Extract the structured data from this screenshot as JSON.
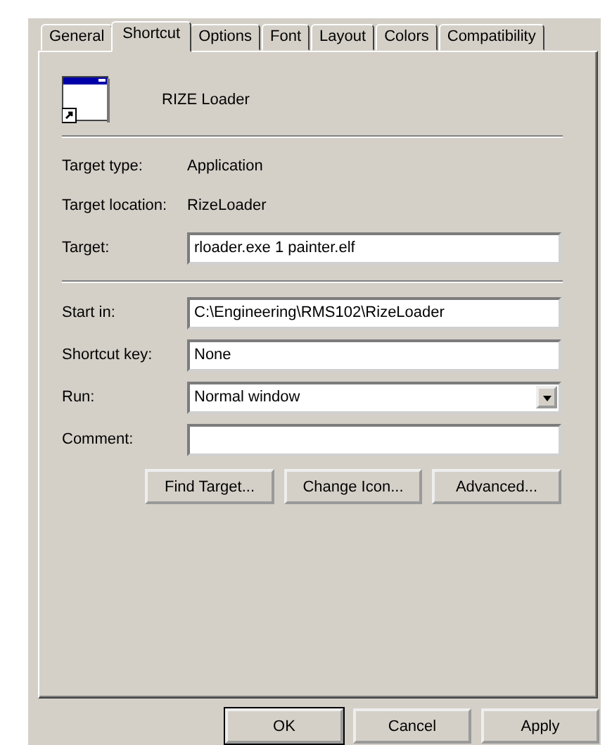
{
  "tabs": [
    {
      "label": "General",
      "selected": false
    },
    {
      "label": "Shortcut",
      "selected": true
    },
    {
      "label": "Options",
      "selected": false
    },
    {
      "label": "Font",
      "selected": false
    },
    {
      "label": "Layout",
      "selected": false
    },
    {
      "label": "Colors",
      "selected": false
    },
    {
      "label": "Compatibility",
      "selected": false
    }
  ],
  "shortcut_name": "RIZE Loader",
  "info": [
    {
      "label": "Target type:",
      "value": "Application"
    },
    {
      "label": "Target location:",
      "value": "RizeLoader"
    }
  ],
  "target": {
    "label": "Target:",
    "value": "rloader.exe 1 painter.elf"
  },
  "fields": [
    {
      "kind": "text",
      "label": "Start in:",
      "value": "C:\\Engineering\\RMS102\\RizeLoader"
    },
    {
      "kind": "text",
      "label": "Shortcut key:",
      "value": "None"
    },
    {
      "kind": "dropdown",
      "label": "Run:",
      "value": "Normal window"
    },
    {
      "kind": "text",
      "label": "Comment:"
    }
  ],
  "actions": [
    "Find Target...",
    "Change Icon...",
    "Advanced..."
  ],
  "dialog_buttons": [
    {
      "label": "OK",
      "default": true
    },
    {
      "label": "Cancel",
      "default": false
    },
    {
      "label": "Apply",
      "default": false
    }
  ]
}
